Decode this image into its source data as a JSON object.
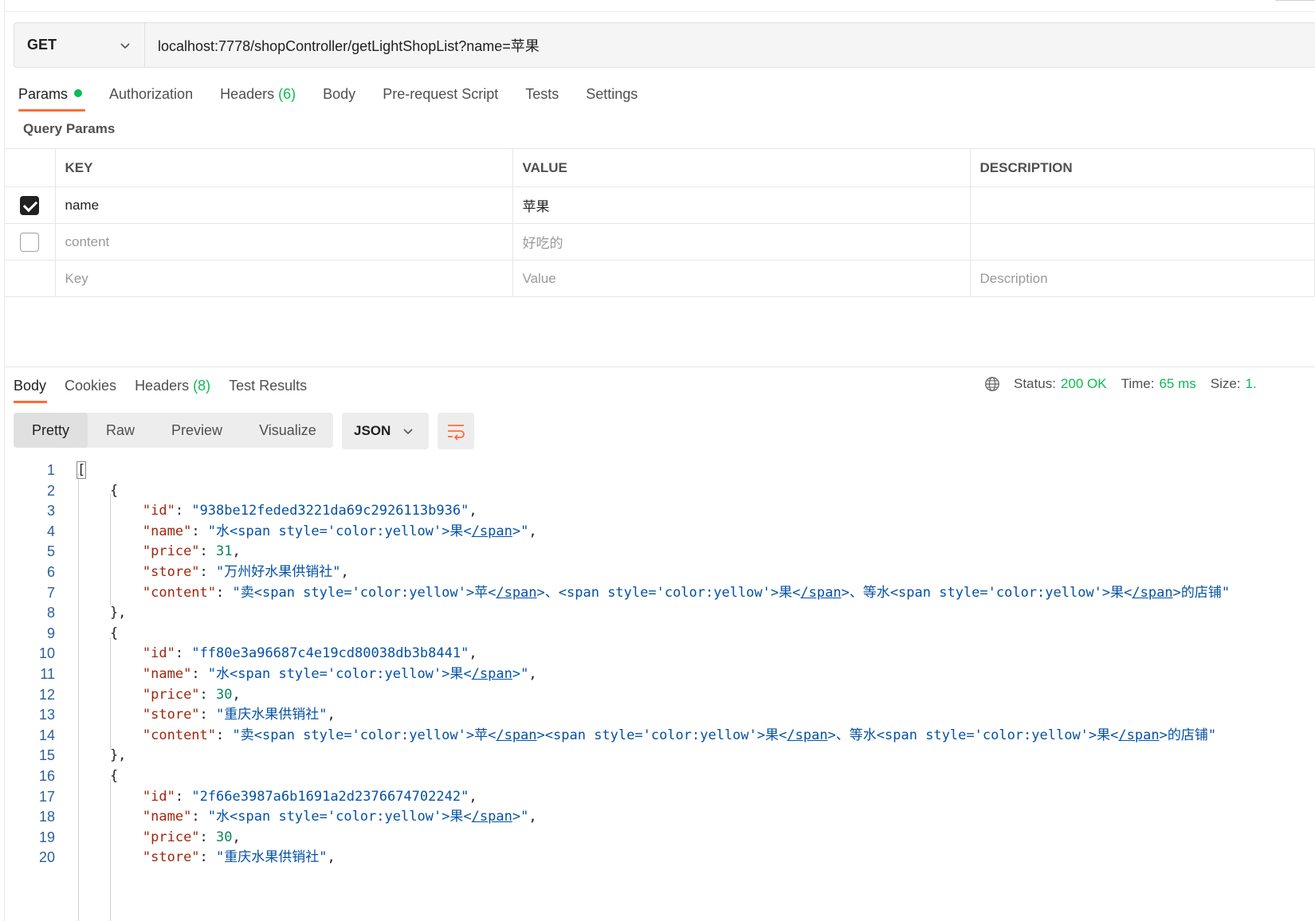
{
  "request": {
    "method": "GET",
    "url": "localhost:7778/shopController/getLightShopList?name=苹果"
  },
  "request_tabs": [
    {
      "label": "Params",
      "active": true,
      "dot": true
    },
    {
      "label": "Authorization"
    },
    {
      "label": "Headers",
      "count": "(6)"
    },
    {
      "label": "Body"
    },
    {
      "label": "Pre-request Script"
    },
    {
      "label": "Tests"
    },
    {
      "label": "Settings"
    }
  ],
  "query_params": {
    "title": "Query Params",
    "headers": {
      "key": "KEY",
      "value": "VALUE",
      "description": "DESCRIPTION"
    },
    "rows": [
      {
        "checked": true,
        "key": "name",
        "value": "苹果",
        "description": ""
      },
      {
        "checked": false,
        "key": "content",
        "value": "好吃的",
        "description": ""
      }
    ],
    "placeholder": {
      "key": "Key",
      "value": "Value",
      "description": "Description"
    }
  },
  "response_tabs": [
    {
      "label": "Body",
      "active": true
    },
    {
      "label": "Cookies"
    },
    {
      "label": "Headers",
      "count": "(8)"
    },
    {
      "label": "Test Results"
    }
  ],
  "status_bar": {
    "status_label": "Status:",
    "status_value": "200 OK",
    "time_label": "Time:",
    "time_value": "65 ms",
    "size_label": "Size:",
    "size_value": "1."
  },
  "view_modes": [
    "Pretty",
    "Raw",
    "Preview",
    "Visualize"
  ],
  "active_view": "Pretty",
  "format": "JSON",
  "colors": {
    "accent": "#ff6c37",
    "success": "#0cbb52",
    "json_key": "#a1260d",
    "json_string": "#0451a5",
    "json_number": "#098658"
  },
  "icons": {
    "method_dropdown": "chevron-down-icon",
    "globe": "globe-icon",
    "format_dropdown": "chevron-down-icon",
    "wrap": "wrap-lines-icon"
  },
  "code": {
    "line_numbers": [
      "1",
      "2",
      "3",
      "4",
      "5",
      "6",
      "7",
      "8",
      "9",
      "10",
      "11",
      "12",
      "13",
      "14",
      "15",
      "16",
      "17",
      "18",
      "19",
      "20"
    ],
    "records": [
      {
        "id": "938be12feded3221da69c2926113b936",
        "name_pre": "水",
        "name_post": "果",
        "price": "31",
        "store": "万州好水果供销社",
        "content_parts": [
          "卖",
          "苹",
          "、",
          "果",
          "、等水",
          "果",
          "的店铺"
        ]
      },
      {
        "id": "ff80e3a96687c4e19cd80038db3b8441",
        "name_pre": "水",
        "name_post": "果",
        "price": "30",
        "store": "重庆水果供销社",
        "content_parts": [
          "卖",
          "苹",
          "",
          "果",
          "、等水",
          "果",
          "的店铺"
        ]
      },
      {
        "id": "2f66e3987a6b1691a2d2376674702242",
        "name_pre": "水",
        "name_post": "果",
        "price": "30",
        "store": "重庆水果供销社"
      }
    ],
    "span_open": "<span style='color:yellow'>",
    "span_close_lt": "<",
    "span_close_tag": "/span",
    "span_close_gt": ">"
  }
}
